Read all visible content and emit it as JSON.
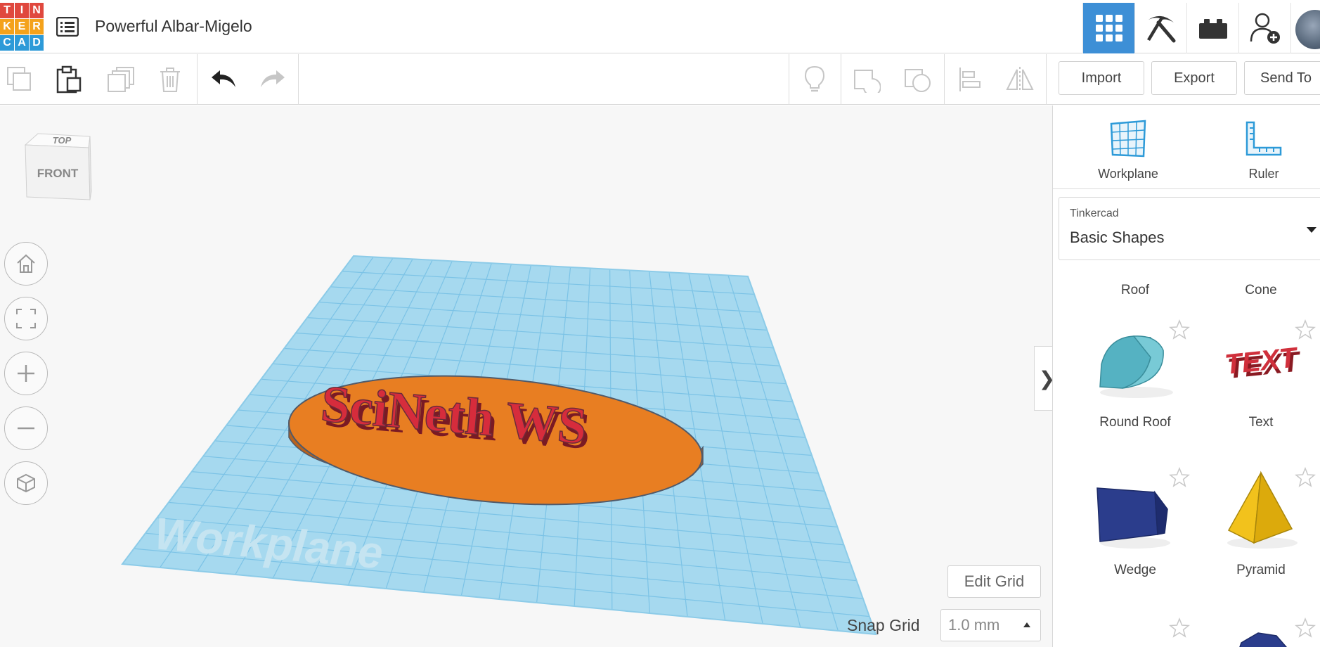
{
  "logo": {
    "letters": [
      "T",
      "I",
      "N",
      "K",
      "E",
      "R",
      "C",
      "A",
      "D"
    ],
    "colors": [
      "#e0483e",
      "#e0483e",
      "#e0483e",
      "#f4a21b",
      "#f4a21b",
      "#f4a21b",
      "#2d9ad8",
      "#2d9ad8",
      "#2d9ad8"
    ]
  },
  "header": {
    "title": "Powerful Albar-Migelo",
    "list_icon": "list-icon",
    "right_buttons": [
      {
        "icon": "grid-view-icon",
        "active": true
      },
      {
        "icon": "pickaxe-icon",
        "active": false
      },
      {
        "icon": "brick-icon",
        "active": false
      },
      {
        "icon": "add-user-icon",
        "active": false
      }
    ]
  },
  "toolbar": {
    "tools": [
      "copy-icon",
      "paste-icon",
      "duplicate-icon",
      "delete-icon",
      "undo-icon",
      "redo-icon",
      "light-bulb-icon",
      "shape-icon",
      "hole-icon",
      "align-icon",
      "mirror-icon"
    ],
    "import_label": "Import",
    "export_label": "Export",
    "sendto_label": "Send To"
  },
  "viewport": {
    "navcube_top": "TOP",
    "navcube_front": "FRONT",
    "controls": [
      "home-icon",
      "fit-view-icon",
      "zoom-in-icon",
      "zoom-out-icon",
      "perspective-icon"
    ],
    "workplane_watermark": "Workplane",
    "object_text": "SciNeth WS",
    "edit_grid_label": "Edit Grid",
    "snap_grid_label": "Snap Grid",
    "snap_grid_value": "1.0 mm",
    "collapse_glyph": "❯",
    "colors": {
      "workplane": "#a6d9ef",
      "grid_line": "#7cc3e6",
      "base": "#e87e22",
      "text": "#d62c3c"
    }
  },
  "panel": {
    "workplane_label": "Workplane",
    "ruler_label": "Ruler",
    "library_category": "Tinkercad",
    "library_value": "Basic Shapes",
    "shapes_top": [
      "Roof",
      "Cone"
    ],
    "shape_row1": [
      "Round Roof",
      "Text"
    ],
    "shape_row2": [
      "Wedge",
      "Pyramid"
    ],
    "shape_text_thumb": "TEXT"
  }
}
